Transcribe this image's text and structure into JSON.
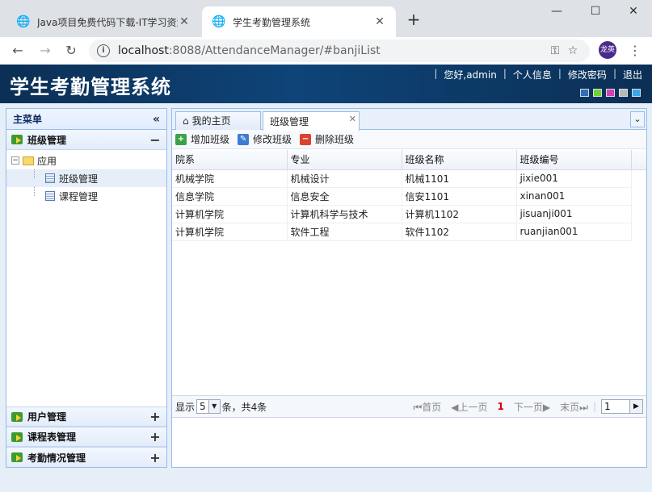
{
  "browser": {
    "tabs": [
      {
        "title": "Java项目免费代码下载-IT学习资源",
        "active": false
      },
      {
        "title": "学生考勤管理系统",
        "active": true
      }
    ],
    "url_host": "localhost",
    "url_rest": ":8088/AttendanceManager/#banjiList",
    "profile_label": "龙英"
  },
  "app": {
    "title": "学生考勤管理系统",
    "links": [
      "您好,admin",
      "个人信息",
      "修改密码",
      "退出"
    ],
    "theme_colors": [
      "#2f6fb8",
      "#6fd136",
      "#d43fb2",
      "#b8b8b8",
      "#3aa7e8"
    ]
  },
  "sidebar": {
    "title": "主菜单",
    "sections": [
      {
        "label": "班级管理",
        "expanded": true
      },
      {
        "label": "用户管理",
        "expanded": false
      },
      {
        "label": "课程表管理",
        "expanded": false
      },
      {
        "label": "考勤情况管理",
        "expanded": false
      }
    ],
    "tree": {
      "root": "应用",
      "children": [
        "班级管理",
        "课程管理"
      ]
    }
  },
  "tabs": {
    "home": "我的主页",
    "active": "班级管理"
  },
  "toolbar": {
    "add": "增加班级",
    "edit": "修改班级",
    "delete": "删除班级"
  },
  "table": {
    "columns": [
      "院系",
      "专业",
      "班级名称",
      "班级编号"
    ],
    "rows": [
      [
        "机械学院",
        "机械设计",
        "机械1101",
        "jixie001"
      ],
      [
        "信息学院",
        "信息安全",
        "信安1101",
        "xinan001"
      ],
      [
        "计算机学院",
        "计算机科学与技术",
        "计算机1102",
        "jisuanji001"
      ],
      [
        "计算机学院",
        "软件工程",
        "软件1102",
        "ruanjian001"
      ]
    ]
  },
  "pager": {
    "show": "显示",
    "page_size": "5",
    "summary": "条，共4条",
    "first": "首页",
    "prev": "上一页",
    "current": "1",
    "next": "下一页",
    "last": "末页",
    "page_input": "1"
  }
}
